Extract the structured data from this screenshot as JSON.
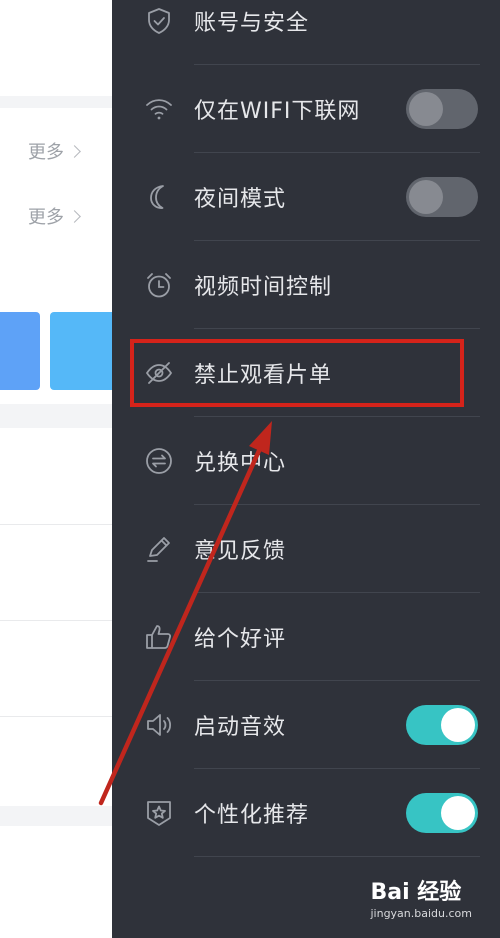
{
  "background_page": {
    "more_links": [
      "更多",
      "更多"
    ]
  },
  "drawer": {
    "items": [
      {
        "label": "账号与安全",
        "icon": "shield-icon"
      },
      {
        "label": "仅在WIFI下联网",
        "icon": "wifi-icon",
        "toggle": "off"
      },
      {
        "label": "夜间模式",
        "icon": "moon-icon",
        "toggle": "off"
      },
      {
        "label": "视频时间控制",
        "icon": "alarm-clock-icon"
      },
      {
        "label": "禁止观看片单",
        "icon": "eye-off-icon"
      },
      {
        "label": "兑换中心",
        "icon": "exchange-icon"
      },
      {
        "label": "意见反馈",
        "icon": "pencil-icon"
      },
      {
        "label": "给个好评",
        "icon": "thumbs-up-icon"
      },
      {
        "label": "启动音效",
        "icon": "speaker-icon",
        "toggle": "on"
      },
      {
        "label": "个性化推荐",
        "icon": "star-badge-icon",
        "toggle": "on"
      }
    ]
  },
  "colors": {
    "drawer_bg": "#2f323a",
    "toggle_on": "#37c4c4",
    "highlight": "#d5231a"
  },
  "watermark": {
    "brand": "Bai 经验",
    "url": "jingyan.baidu.com"
  }
}
